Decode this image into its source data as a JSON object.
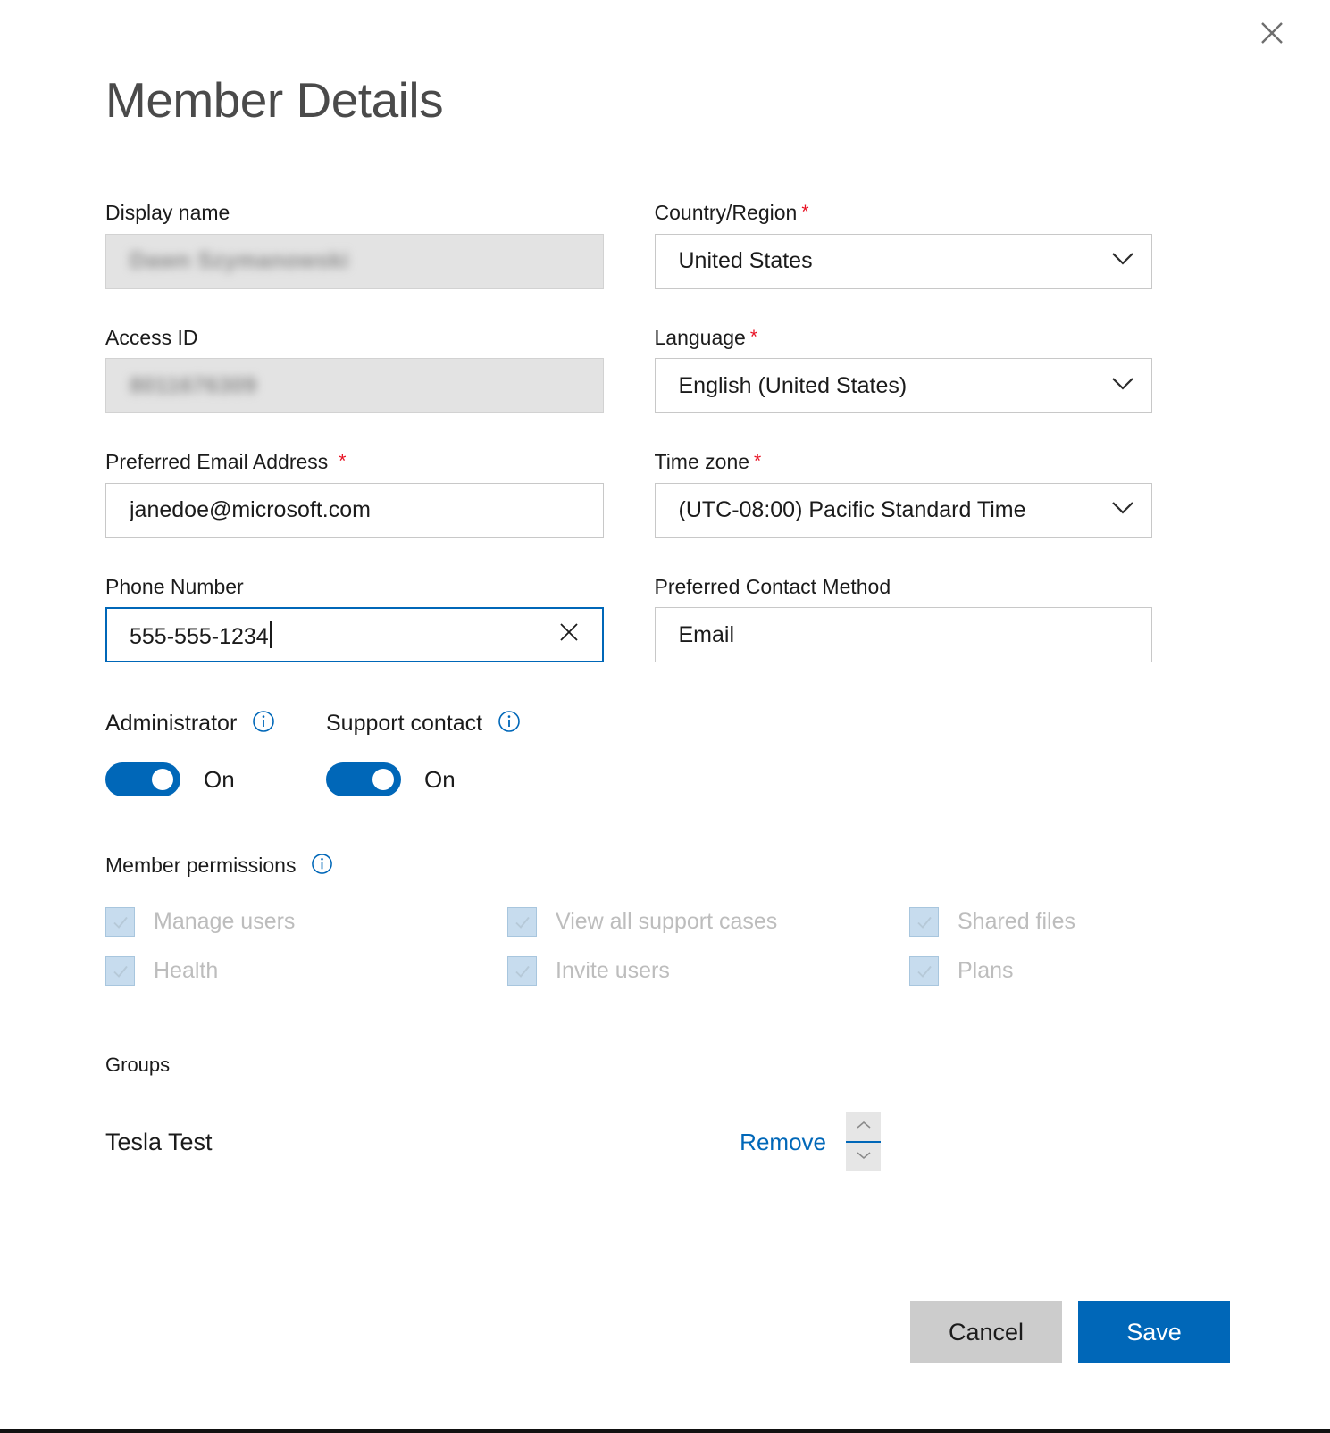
{
  "dialog": {
    "title": "Member Details",
    "close_icon": "close-icon"
  },
  "fields": {
    "display_name": {
      "label": "Display name",
      "value": "Dawn Szymanowski",
      "required": false,
      "disabled": true,
      "redacted": true
    },
    "access_id": {
      "label": "Access ID",
      "value": "8011676309",
      "required": false,
      "disabled": true,
      "redacted": true
    },
    "preferred_email": {
      "label": "Preferred Email Address",
      "value": "janedoe@microsoft.com",
      "required": true,
      "disabled": false
    },
    "phone_number": {
      "label": "Phone Number",
      "value": "555-555-1234",
      "required": false,
      "disabled": false,
      "focused": true,
      "clear_icon": "close-icon"
    },
    "country_region": {
      "label": "Country/Region",
      "value": "United States",
      "required": true,
      "chevron_icon": "chevron-down-icon"
    },
    "language": {
      "label": "Language",
      "value": "English (United States)",
      "required": true,
      "chevron_icon": "chevron-down-icon"
    },
    "time_zone": {
      "label": "Time zone",
      "value": "(UTC-08:00) Pacific Standard Time",
      "required": true,
      "chevron_icon": "chevron-down-icon"
    },
    "contact_method": {
      "label": "Preferred Contact Method",
      "value": "Email",
      "required": false
    }
  },
  "toggles": {
    "administrator": {
      "label": "Administrator",
      "state": "On",
      "on": true,
      "info_icon": "info-icon"
    },
    "support_contact": {
      "label": "Support contact",
      "state": "On",
      "on": true,
      "info_icon": "info-icon"
    }
  },
  "permissions": {
    "title": "Member permissions",
    "info_icon": "info-icon",
    "items": [
      {
        "label": "Manage users",
        "checked": true,
        "disabled": true
      },
      {
        "label": "View all support cases",
        "checked": true,
        "disabled": true
      },
      {
        "label": "Shared files",
        "checked": true,
        "disabled": true
      },
      {
        "label": "Health",
        "checked": true,
        "disabled": true
      },
      {
        "label": "Invite users",
        "checked": true,
        "disabled": true
      },
      {
        "label": "Plans",
        "checked": true,
        "disabled": true
      }
    ]
  },
  "groups": {
    "title": "Groups",
    "rows": [
      {
        "name": "Tesla Test",
        "remove_label": "Remove"
      }
    ],
    "spinner": {
      "up_icon": "chevron-up-icon",
      "down_icon": "chevron-down-icon"
    }
  },
  "footer": {
    "cancel_label": "Cancel",
    "save_label": "Save"
  },
  "colors": {
    "accent": "#0067b8",
    "required_star": "#e81123",
    "disabled_field_bg": "#e3e3e3",
    "checkbox_fill": "#c7dcee",
    "cancel_bg": "#cccccc"
  }
}
